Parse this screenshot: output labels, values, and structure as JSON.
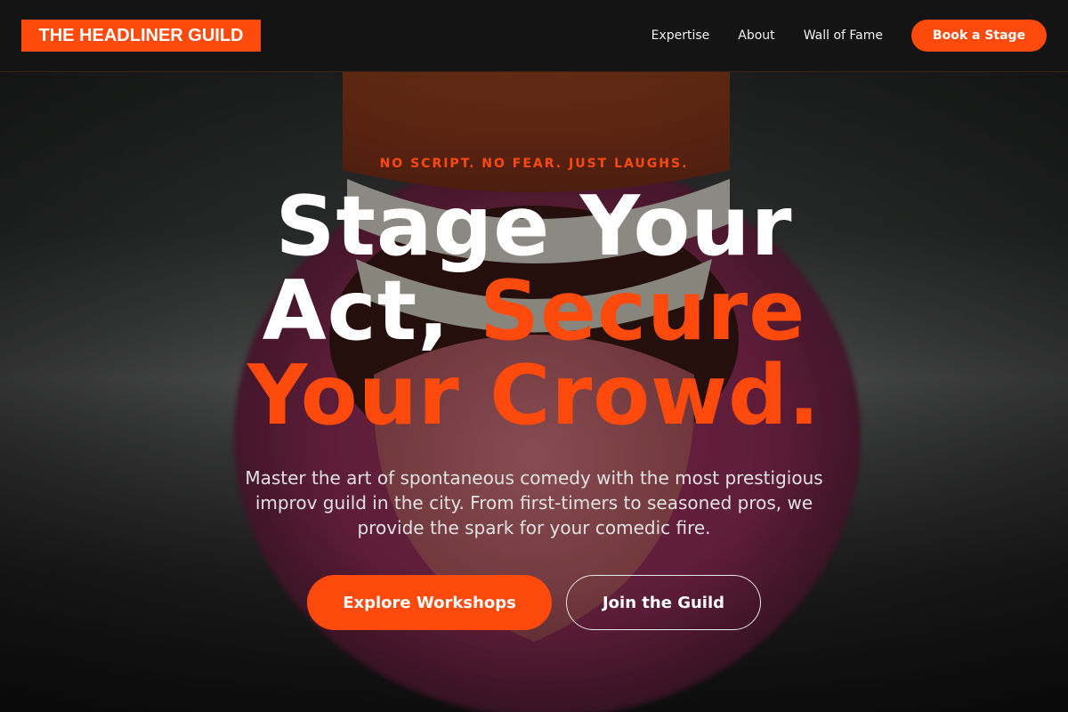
{
  "brand": {
    "logo_text": "THE HEADLINER GUILD",
    "accent_color": "#ff4a0d"
  },
  "nav": {
    "links": [
      "Expertise",
      "About",
      "Wall of Fame"
    ],
    "cta_label": "Book a Stage"
  },
  "hero": {
    "background_image": "close-up of a pink fuzzy character with an open mouth showing teeth, dimmed behind text",
    "eyebrow": "NO SCRIPT. NO FEAR. JUST LAUGHS.",
    "headline": {
      "line1": "Stage Your",
      "line2_white": "Act, ",
      "line2_accent": "Secure",
      "line3_accent": "Your Crowd."
    },
    "subtitle": "Master the art of spontaneous comedy with the most prestigious improv guild in the city. From first-timers to seasoned pros, we provide the spark for your comedic fire.",
    "primary_cta": "Explore Workshops",
    "secondary_cta": "Join the Guild"
  }
}
